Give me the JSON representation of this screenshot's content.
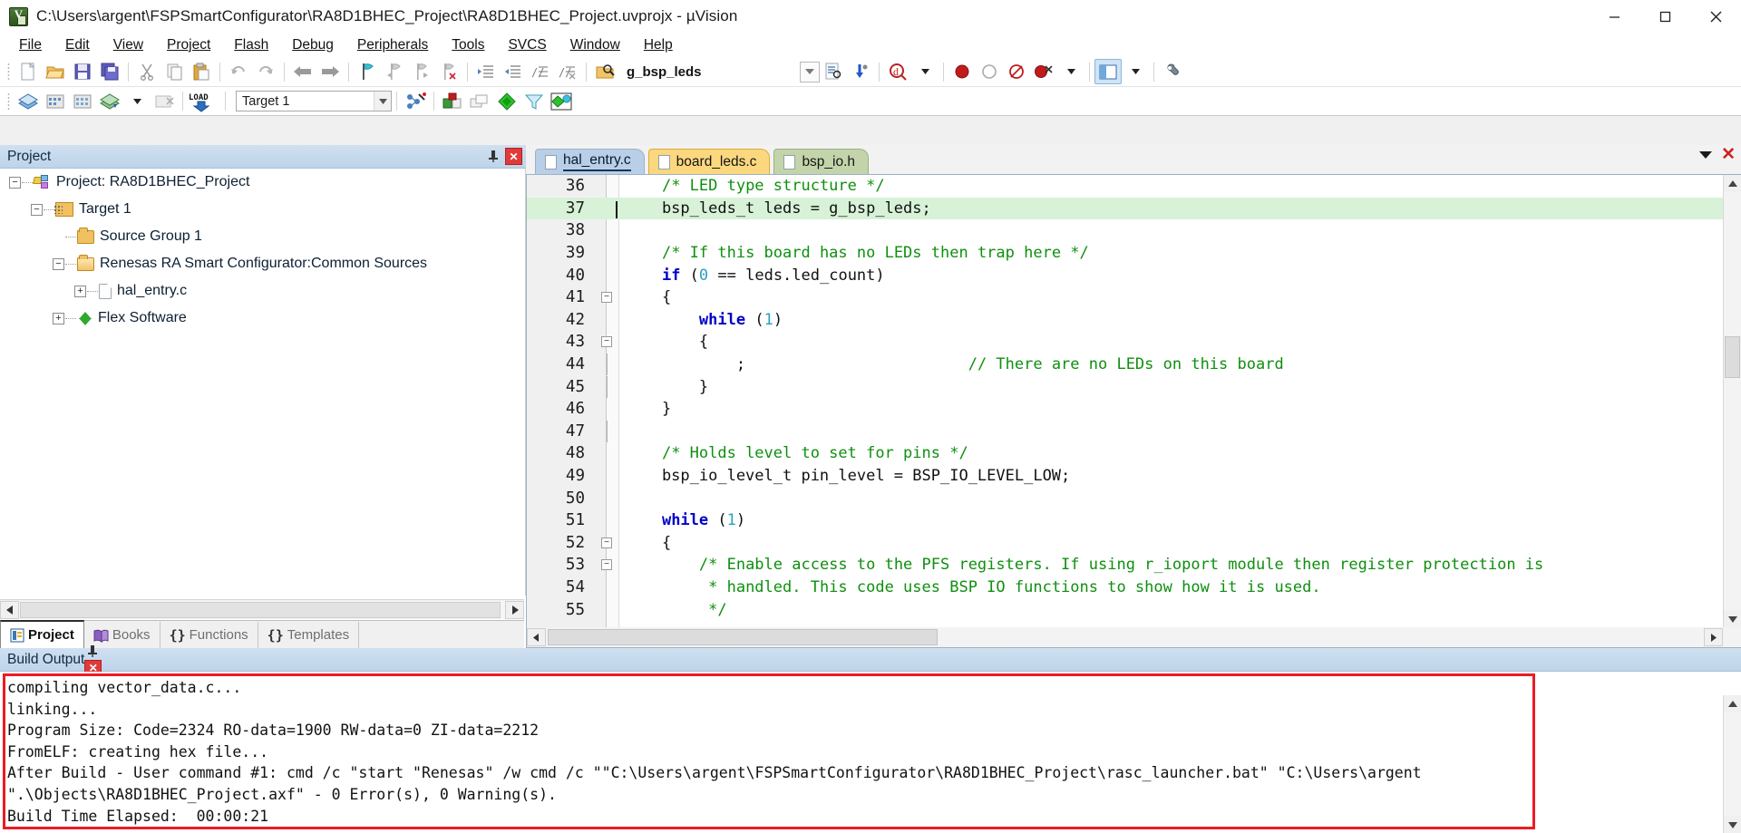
{
  "window": {
    "title": "C:\\Users\\argent\\FSPSmartConfigurator\\RA8D1BHEC_Project\\RA8D1BHEC_Project.uvprojx - µVision",
    "minimize_label": "—",
    "maximize_label": "▢",
    "close_label": "✕"
  },
  "menu": [
    {
      "label": "File"
    },
    {
      "label": "Edit"
    },
    {
      "label": "View"
    },
    {
      "label": "Project"
    },
    {
      "label": "Flash"
    },
    {
      "label": "Debug"
    },
    {
      "label": "Peripherals"
    },
    {
      "label": "Tools"
    },
    {
      "label": "SVCS"
    },
    {
      "label": "Window"
    },
    {
      "label": "Help"
    }
  ],
  "toolbar": {
    "search_value": "g_bsp_leds",
    "target_value": "Target 1",
    "load_label": "LOAD"
  },
  "project_panel": {
    "title": "Project",
    "tree": [
      {
        "label": "Project: RA8D1BHEC_Project",
        "indent": 0,
        "expander": "-",
        "icon": "project-icon"
      },
      {
        "label": "Target 1",
        "indent": 1,
        "expander": "-",
        "icon": "target-folder-icon"
      },
      {
        "label": "Source Group 1",
        "indent": 2,
        "expander": "",
        "icon": "folder-icon"
      },
      {
        "label": "Renesas RA Smart Configurator:Common Sources",
        "indent": 2,
        "expander": "-",
        "icon": "folder-open-icon"
      },
      {
        "label": "hal_entry.c",
        "indent": 3,
        "expander": "+",
        "icon": "c-file-icon"
      },
      {
        "label": "Flex Software",
        "indent": 2,
        "expander": "+",
        "icon": "flex-software-icon"
      }
    ],
    "bottom_tabs": [
      {
        "label": "Project",
        "active": true
      },
      {
        "label": "Books",
        "active": false
      },
      {
        "label": "Functions",
        "active": false
      },
      {
        "label": "Templates",
        "active": false
      }
    ]
  },
  "editor": {
    "tabs": [
      {
        "label": "hal_entry.c",
        "state": "active"
      },
      {
        "label": "board_leds.c",
        "state": "orange"
      },
      {
        "label": "bsp_io.h",
        "state": "green"
      }
    ],
    "lines": [
      {
        "no": "36",
        "fold": "",
        "highlight": false,
        "segments": [
          {
            "t": "    ",
            "c": "pl"
          },
          {
            "t": "/* LED type structure */",
            "c": "cm"
          }
        ]
      },
      {
        "no": "37",
        "fold": "",
        "highlight": true,
        "segments": [
          {
            "t": "    bsp_leds_t leds = g_bsp_leds;",
            "c": "pl"
          }
        ]
      },
      {
        "no": "38",
        "fold": "",
        "highlight": false,
        "segments": [
          {
            "t": "",
            "c": "pl"
          }
        ]
      },
      {
        "no": "39",
        "fold": "",
        "highlight": false,
        "segments": [
          {
            "t": "    ",
            "c": "pl"
          },
          {
            "t": "/* If this board has no LEDs then trap here */",
            "c": "cm"
          }
        ]
      },
      {
        "no": "40",
        "fold": "",
        "highlight": false,
        "segments": [
          {
            "t": "    ",
            "c": "pl"
          },
          {
            "t": "if",
            "c": "kw"
          },
          {
            "t": " (",
            "c": "pl"
          },
          {
            "t": "0",
            "c": "num"
          },
          {
            "t": " == leds.led_count)",
            "c": "pl"
          }
        ]
      },
      {
        "no": "41",
        "fold": "-",
        "highlight": false,
        "segments": [
          {
            "t": "    {",
            "c": "pl"
          }
        ]
      },
      {
        "no": "42",
        "fold": "",
        "highlight": false,
        "segments": [
          {
            "t": "        ",
            "c": "pl"
          },
          {
            "t": "while",
            "c": "kw"
          },
          {
            "t": " (",
            "c": "pl"
          },
          {
            "t": "1",
            "c": "num"
          },
          {
            "t": ")",
            "c": "pl"
          }
        ]
      },
      {
        "no": "43",
        "fold": "-",
        "highlight": false,
        "segments": [
          {
            "t": "        {",
            "c": "pl"
          }
        ]
      },
      {
        "no": "44",
        "fold": "|",
        "highlight": false,
        "segments": [
          {
            "t": "            ;                        ",
            "c": "pl"
          },
          {
            "t": "// There are no LEDs on this board",
            "c": "cm"
          }
        ]
      },
      {
        "no": "45",
        "fold": "|",
        "highlight": false,
        "segments": [
          {
            "t": "        }",
            "c": "pl"
          }
        ]
      },
      {
        "no": "46",
        "fold": "",
        "highlight": false,
        "segments": [
          {
            "t": "    }",
            "c": "pl"
          }
        ]
      },
      {
        "no": "47",
        "fold": "|",
        "highlight": false,
        "segments": [
          {
            "t": "",
            "c": "pl"
          }
        ]
      },
      {
        "no": "48",
        "fold": "",
        "highlight": false,
        "segments": [
          {
            "t": "    ",
            "c": "pl"
          },
          {
            "t": "/* Holds level to set for pins */",
            "c": "cm"
          }
        ]
      },
      {
        "no": "49",
        "fold": "",
        "highlight": false,
        "segments": [
          {
            "t": "    bsp_io_level_t pin_level = BSP_IO_LEVEL_LOW;",
            "c": "pl"
          }
        ]
      },
      {
        "no": "50",
        "fold": "",
        "highlight": false,
        "segments": [
          {
            "t": "",
            "c": "pl"
          }
        ]
      },
      {
        "no": "51",
        "fold": "",
        "highlight": false,
        "segments": [
          {
            "t": "    ",
            "c": "pl"
          },
          {
            "t": "while",
            "c": "kw"
          },
          {
            "t": " (",
            "c": "pl"
          },
          {
            "t": "1",
            "c": "num"
          },
          {
            "t": ")",
            "c": "pl"
          }
        ]
      },
      {
        "no": "52",
        "fold": "-",
        "highlight": false,
        "segments": [
          {
            "t": "    {",
            "c": "pl"
          }
        ]
      },
      {
        "no": "53",
        "fold": "-",
        "highlight": false,
        "segments": [
          {
            "t": "        ",
            "c": "pl"
          },
          {
            "t": "/* Enable access to the PFS registers. If using r_ioport module then register protection is",
            "c": "cm"
          }
        ]
      },
      {
        "no": "54",
        "fold": "",
        "highlight": false,
        "segments": [
          {
            "t": "         ",
            "c": "pl"
          },
          {
            "t": "* handled. This code uses BSP IO functions to show how it is used.",
            "c": "cm"
          }
        ]
      },
      {
        "no": "55",
        "fold": "",
        "highlight": false,
        "segments": [
          {
            "t": "         ",
            "c": "pl"
          },
          {
            "t": "*/",
            "c": "cm"
          }
        ]
      }
    ]
  },
  "build_output": {
    "title": "Build Output",
    "lines": [
      "compiling vector_data.c...",
      "linking...",
      "Program Size: Code=2324 RO-data=1900 RW-data=0 ZI-data=2212",
      "FromELF: creating hex file...",
      "After Build - User command #1: cmd /c \"start \"Renesas\" /w cmd /c \"\"C:\\Users\\argent\\FSPSmartConfigurator\\RA8D1BHEC_Project\\rasc_launcher.bat\" \"C:\\Users\\argent",
      "\".\\Objects\\RA8D1BHEC_Project.axf\" - 0 Error(s), 0 Warning(s).",
      "Build Time Elapsed:  00:00:21"
    ]
  },
  "colors": {
    "accent_blue": "#b9cfe8",
    "error_red": "#ec1c24",
    "highlight_green": "#d8f2d8",
    "comment_green": "#0f8f0f",
    "keyword_blue": "#0000c8"
  }
}
